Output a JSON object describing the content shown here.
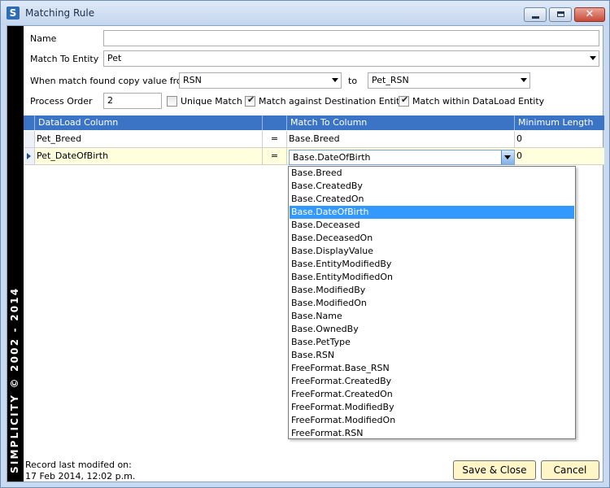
{
  "window": {
    "title": "Matching Rule",
    "app_icon_letter": "S",
    "close_glyph": "✕"
  },
  "sidebar": {
    "text": "SIMPLICITY © 2002 - 2014"
  },
  "form": {
    "name_label": "Name",
    "name_value": "",
    "match_entity_label": "Match To Entity",
    "match_entity_value": "Pet",
    "copy_label": "When match found copy value from",
    "copy_from_value": "RSN",
    "to_label": "to",
    "copy_to_value": "Pet_RSN",
    "process_order_label": "Process Order",
    "process_order_value": "2",
    "unique_match_label": "Unique Match",
    "unique_match_checked": false,
    "match_destination_label": "Match against Destination Entity",
    "match_destination_checked": true,
    "match_dataload_label": "Match within DataLoad Entity",
    "match_dataload_checked": true
  },
  "grid": {
    "columns": [
      "DataLoad Column",
      "",
      "Match To Column",
      "Minimum Length"
    ],
    "rows": [
      {
        "dataload": "Pet_Breed",
        "op": "=",
        "match": "Base.Breed",
        "min": "0"
      },
      {
        "dataload": "Pet_DateOfBirth",
        "op": "=",
        "match": "Base.DateOfBirth",
        "min": "0"
      }
    ]
  },
  "dropdown": {
    "items": [
      "Base.Breed",
      "Base.CreatedBy",
      "Base.CreatedOn",
      "Base.DateOfBirth",
      "Base.Deceased",
      "Base.DeceasedOn",
      "Base.DisplayValue",
      "Base.EntityModifiedBy",
      "Base.EntityModifiedOn",
      "Base.ModifiedBy",
      "Base.ModifiedOn",
      "Base.Name",
      "Base.OwnedBy",
      "Base.PetType",
      "Base.RSN",
      "FreeFormat.Base_RSN",
      "FreeFormat.CreatedBy",
      "FreeFormat.CreatedOn",
      "FreeFormat.ModifiedBy",
      "FreeFormat.ModifiedOn",
      "FreeFormat.RSN"
    ],
    "selected": "Base.DateOfBirth"
  },
  "footer": {
    "modified_label": "Record last modifed on:",
    "modified_value": "17 Feb 2014, 12:02 p.m.",
    "save_label": "Save & Close",
    "cancel_label": "Cancel"
  },
  "colors": {
    "grid_header": "#3b74c4",
    "edit_row": "#ffffdd",
    "selection": "#3399ff",
    "button_face": "#fff6c8"
  }
}
